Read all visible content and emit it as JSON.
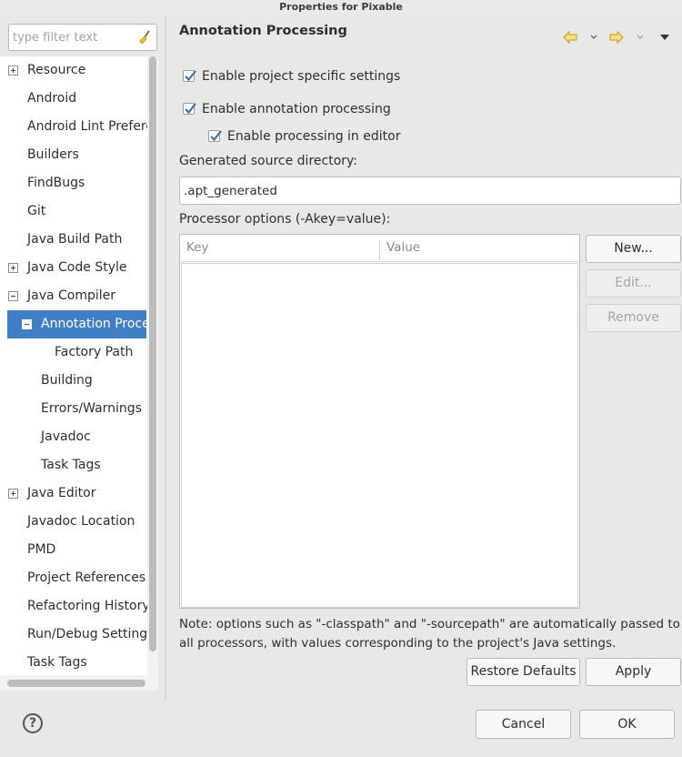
{
  "window": {
    "title": "Properties for Pixable"
  },
  "filter": {
    "placeholder": "type filter text"
  },
  "tree": [
    {
      "label": "Resource",
      "expander": "plus",
      "selected": false
    },
    {
      "label": "Android"
    },
    {
      "label": "Android Lint Preferences"
    },
    {
      "label": "Builders"
    },
    {
      "label": "FindBugs"
    },
    {
      "label": "Git"
    },
    {
      "label": "Java Build Path"
    },
    {
      "label": "Java Code Style",
      "expander": "plus"
    },
    {
      "label": "Java Compiler",
      "expander": "minus"
    },
    {
      "label": "Annotation Processing",
      "expander": "minus",
      "selected": true
    },
    {
      "label": "Factory Path"
    },
    {
      "label": "Building"
    },
    {
      "label": "Errors/Warnings"
    },
    {
      "label": "Javadoc"
    },
    {
      "label": "Task Tags"
    },
    {
      "label": "Java Editor",
      "expander": "plus"
    },
    {
      "label": "Javadoc Location"
    },
    {
      "label": "PMD"
    },
    {
      "label": "Project References"
    },
    {
      "label": "Refactoring History"
    },
    {
      "label": "Run/Debug Settings"
    },
    {
      "label": "Task Tags"
    }
  ],
  "page": {
    "title": "Annotation Processing",
    "enable_project_specific": {
      "label": "Enable project specific settings",
      "checked": true
    },
    "enable_annotation_processing": {
      "label": "Enable annotation processing",
      "checked": true
    },
    "enable_in_editor": {
      "label": "Enable processing in editor",
      "checked": true
    },
    "generated_dir_label": "Generated source directory:",
    "generated_dir_value": ".apt_generated",
    "processor_options_label": "Processor options (-Akey=value):",
    "table": {
      "columns": [
        "Key",
        "Value"
      ],
      "rows": []
    },
    "buttons": {
      "new": "New...",
      "edit": "Edit...",
      "remove": "Remove"
    },
    "note": "Note: options such as \"-classpath\" and \"-sourcepath\" are automatically passed to all processors, with values corresponding to the project's Java settings.",
    "restore_defaults": "Restore Defaults",
    "apply": "Apply"
  },
  "footer": {
    "cancel": "Cancel",
    "ok": "OK",
    "help_glyph": "?"
  },
  "colors": {
    "selection": "#3f7fc6",
    "nav_arrow": "#d8b13a",
    "checkmark": "#3b6fb0"
  }
}
